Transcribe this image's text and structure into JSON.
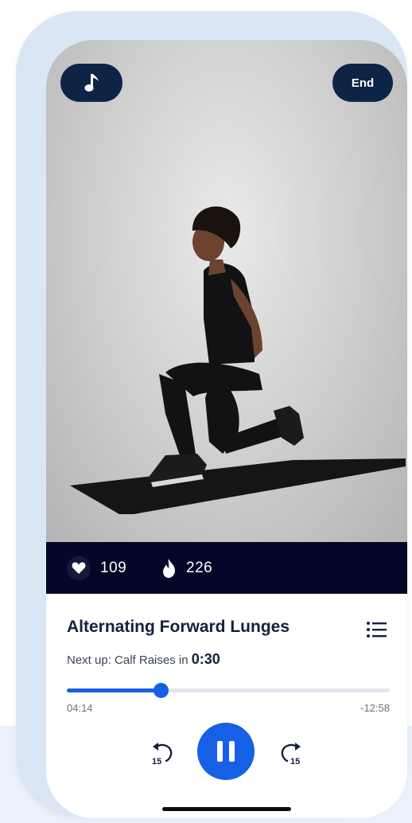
{
  "video": {
    "music_icon": "music-note-icon",
    "end_label": "End"
  },
  "stats": {
    "hearts_icon": "heart-icon",
    "hearts": "109",
    "calories_icon": "flame-icon",
    "calories": "226"
  },
  "exercise": {
    "title": "Alternating Forward Lunges",
    "next_up_prefix": "Next up: Calf Raises in",
    "next_up_time": "0:30",
    "list_icon": "list-icon"
  },
  "playback": {
    "elapsed": "04:14",
    "remaining": "-12:58",
    "progress_fraction": 0.29,
    "rewind_icon": "rewind-15-icon",
    "rewind_seconds": "15",
    "pause_icon": "pause-icon",
    "forward_icon": "forward-15-icon",
    "forward_seconds": "15"
  },
  "colors": {
    "accent": "#1660e6",
    "navy": "#0e2447",
    "stats_bar": "#040828"
  }
}
